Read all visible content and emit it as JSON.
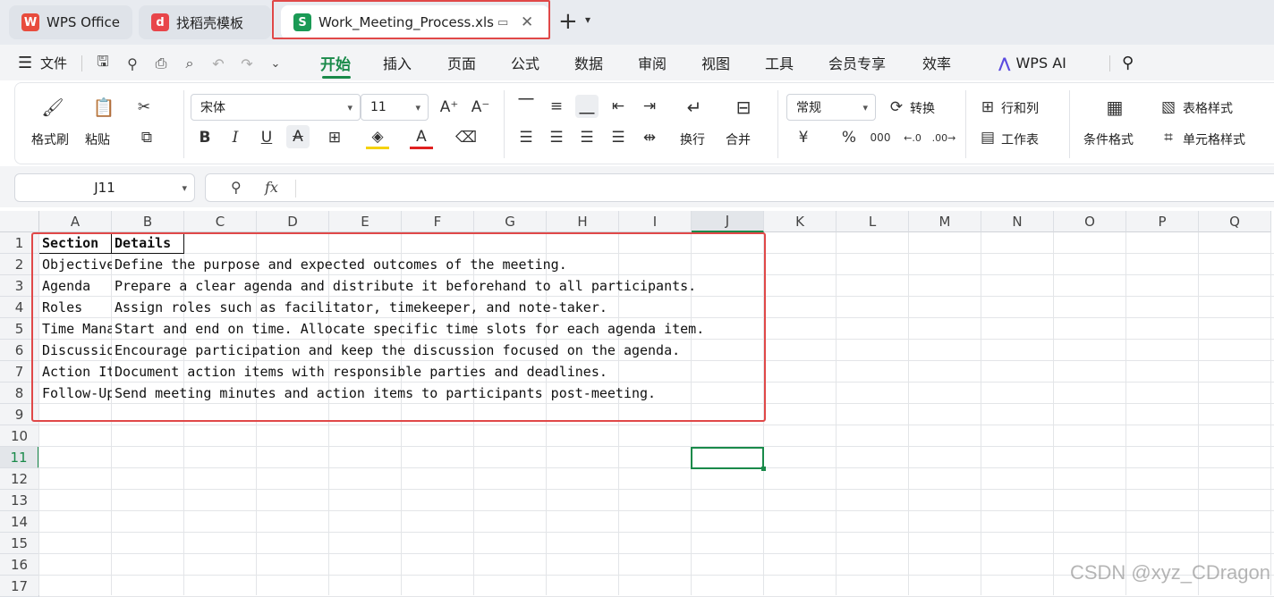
{
  "tabs": {
    "wps_office": "WPS Office",
    "docer": "找稻壳模板",
    "file": "Work_Meeting_Process.xlsx"
  },
  "menu": {
    "file": "文件",
    "items": [
      "开始",
      "插入",
      "页面",
      "公式",
      "数据",
      "审阅",
      "视图",
      "工具",
      "会员专享",
      "效率"
    ],
    "wps_ai": "WPS AI"
  },
  "ribbon": {
    "format_painter": "格式刷",
    "paste": "粘贴",
    "font_name": "宋体",
    "font_size": "11",
    "wrap": "换行",
    "merge": "合并",
    "number_format": "常规",
    "convert": "转换",
    "rows_cols": "行和列",
    "worksheet": "工作表",
    "conditional_format": "条件格式",
    "table_style": "表格样式",
    "cell_style": "单元格样式",
    "currency": "¥",
    "percent": "%"
  },
  "formula_bar": {
    "name_box": "J11",
    "fx": "fx"
  },
  "sheet": {
    "columns": [
      "A",
      "B",
      "C",
      "D",
      "E",
      "F",
      "G",
      "H",
      "I",
      "J",
      "K",
      "L",
      "M",
      "N",
      "O",
      "P",
      "Q"
    ],
    "rows": [
      "1",
      "2",
      "3",
      "4",
      "5",
      "6",
      "7",
      "8",
      "9",
      "10",
      "11",
      "12",
      "13",
      "14",
      "15",
      "16",
      "17"
    ],
    "header": [
      "Section",
      "Details"
    ],
    "data": [
      [
        "Objective",
        "Define the purpose and expected outcomes of the meeting."
      ],
      [
        "Agenda",
        "Prepare a clear agenda and distribute it beforehand to all participants."
      ],
      [
        "Roles",
        "Assign roles such as facilitator, timekeeper, and note-taker."
      ],
      [
        "Time Management",
        "Start and end on time. Allocate specific time slots for each agenda item."
      ],
      [
        "Discussion",
        "Encourage participation and keep the discussion focused on the agenda."
      ],
      [
        "Action Items",
        "Document action items with responsible parties and deadlines."
      ],
      [
        "Follow-Up",
        "Send meeting minutes and action items to participants post-meeting."
      ]
    ],
    "selected_cell": "J11"
  },
  "watermark": "CSDN @xyz_CDragon",
  "colors": {
    "accent": "#1a8a4a",
    "annotation": "#e04848"
  }
}
